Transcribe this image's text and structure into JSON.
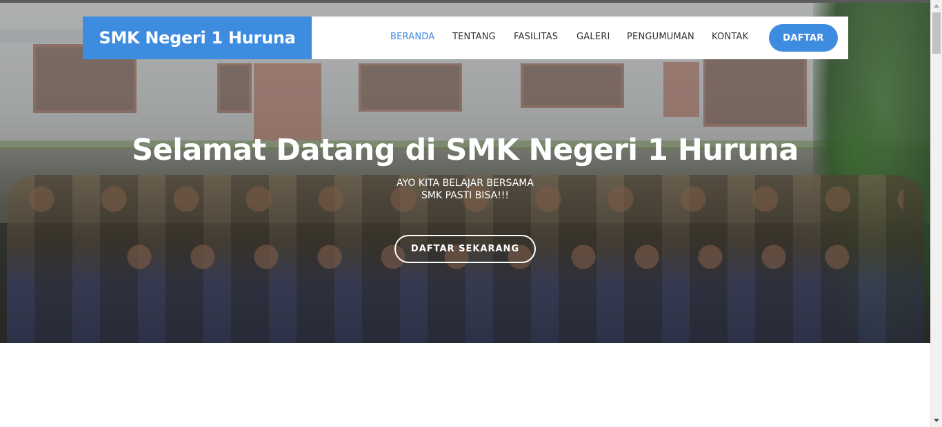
{
  "header": {
    "brand": "SMK Negeri 1 Huruna",
    "nav": [
      {
        "label": "BERANDA",
        "active": true
      },
      {
        "label": "TENTANG",
        "active": false
      },
      {
        "label": "FASILITAS",
        "active": false
      },
      {
        "label": "GALERI",
        "active": false
      },
      {
        "label": "PENGUMUMAN",
        "active": false
      },
      {
        "label": "KONTAK",
        "active": false
      }
    ],
    "cta": "DAFTAR"
  },
  "hero": {
    "title": "Selamat Datang di SMK Negeri 1 Huruna",
    "subtitle_line1": "AYO KITA BELAJAR BERSAMA",
    "subtitle_line2": "SMK PASTI BISA!!!",
    "button": "DAFTAR SEKARANG"
  },
  "colors": {
    "accent": "#3e8ce0",
    "text_dark": "#333333",
    "white": "#ffffff"
  }
}
